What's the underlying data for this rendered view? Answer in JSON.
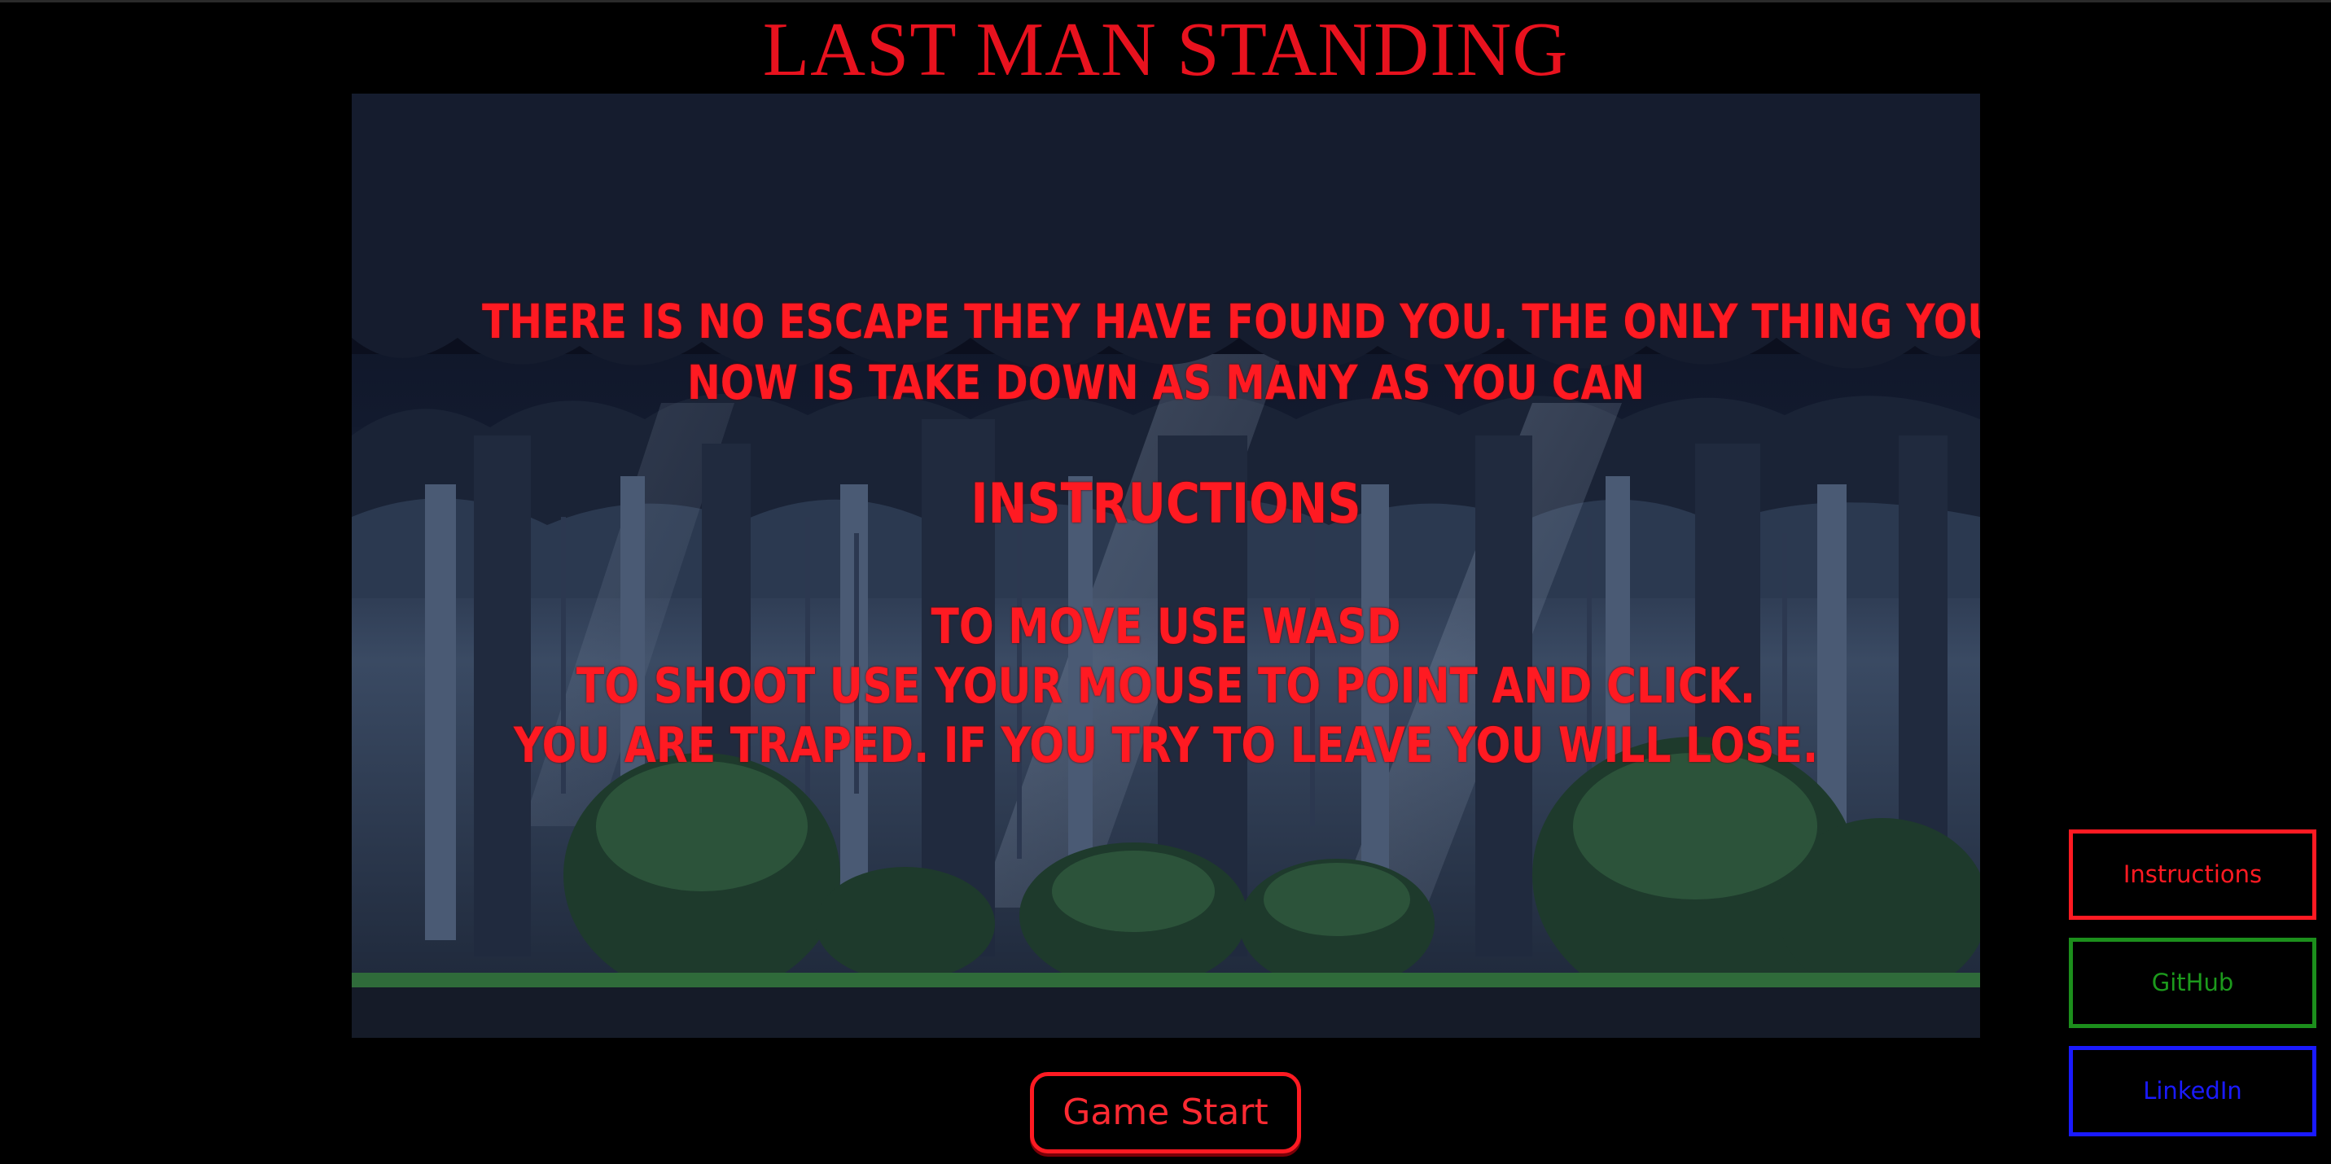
{
  "header": {
    "title": "LAST MAN STANDING"
  },
  "story": {
    "intro_line_1": "There is no escape they have found you. The only thing you can do",
    "intro_line_2": "now is take down as many as you can",
    "instructions_heading": "Instructions",
    "instruction_lines": [
      "To move use WASD",
      "To shoot use your mouse to point and click.",
      "You are traped. If you try to leave you will lose."
    ]
  },
  "buttons": {
    "game_start": "Game Start"
  },
  "side_links": {
    "instructions": "Instructions",
    "github": "GitHub",
    "linkedin": "LinkedIn"
  },
  "colors": {
    "accent_red": "#ff1a22",
    "github_green": "#1c8f1c",
    "linkedin_blue": "#1a1aff",
    "background": "#000000"
  },
  "scene": {
    "background_art": "pixel-art night forest"
  }
}
